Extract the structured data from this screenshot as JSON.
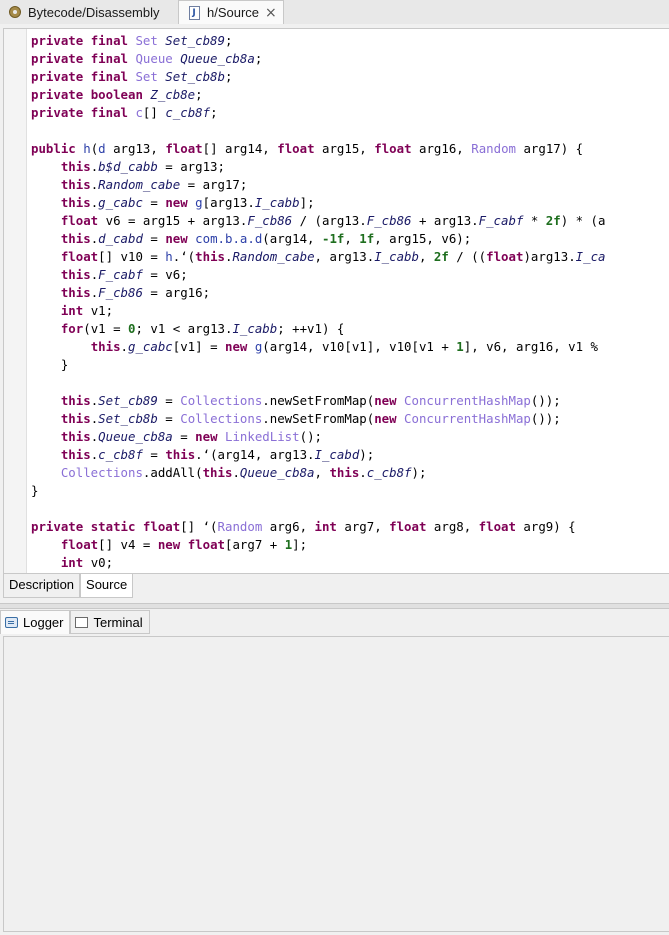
{
  "top_tabs": [
    {
      "label": "Bytecode/Disassembly",
      "icon": "gear-icon"
    },
    {
      "label": "h/Source",
      "icon": "java-file-icon",
      "closable": true
    }
  ],
  "code_lines": [
    [
      [
        "kw",
        "private "
      ],
      [
        "kw",
        "final "
      ],
      [
        "ty",
        "Set "
      ],
      [
        "fd",
        "Set_cb89"
      ],
      [
        "p",
        ";"
      ]
    ],
    [
      [
        "kw",
        "private "
      ],
      [
        "kw",
        "final "
      ],
      [
        "ty",
        "Queue "
      ],
      [
        "fd",
        "Queue_cb8a"
      ],
      [
        "p",
        ";"
      ]
    ],
    [
      [
        "kw",
        "private "
      ],
      [
        "kw",
        "final "
      ],
      [
        "ty",
        "Set "
      ],
      [
        "fd",
        "Set_cb8b"
      ],
      [
        "p",
        ";"
      ]
    ],
    [
      [
        "kw",
        "private "
      ],
      [
        "kw",
        "boolean "
      ],
      [
        "fd",
        "Z_cb8e"
      ],
      [
        "p",
        ";"
      ]
    ],
    [
      [
        "kw",
        "private "
      ],
      [
        "kw",
        "final "
      ],
      [
        "ty",
        "c"
      ],
      [
        "p",
        "[] "
      ],
      [
        "fd",
        "c_cb8f"
      ],
      [
        "p",
        ";"
      ]
    ],
    [],
    [
      [
        "kw",
        "public "
      ],
      [
        "cls",
        "h"
      ],
      [
        "p",
        "("
      ],
      [
        "cls",
        "d"
      ],
      [
        "p",
        " arg13, "
      ],
      [
        "kw",
        "float"
      ],
      [
        "p",
        "[] arg14, "
      ],
      [
        "kw",
        "float"
      ],
      [
        "p",
        " arg15, "
      ],
      [
        "kw",
        "float"
      ],
      [
        "p",
        " arg16, "
      ],
      [
        "ty",
        "Random"
      ],
      [
        "p",
        " arg17) {"
      ]
    ],
    [
      [
        "p",
        "    "
      ],
      [
        "kw",
        "this"
      ],
      [
        "p",
        "."
      ],
      [
        "fd",
        "b$d_cabb"
      ],
      [
        "p",
        " = arg13;"
      ]
    ],
    [
      [
        "p",
        "    "
      ],
      [
        "kw",
        "this"
      ],
      [
        "p",
        "."
      ],
      [
        "fd",
        "Random_cabe"
      ],
      [
        "p",
        " = arg17;"
      ]
    ],
    [
      [
        "p",
        "    "
      ],
      [
        "kw",
        "this"
      ],
      [
        "p",
        "."
      ],
      [
        "fd",
        "g_cabc"
      ],
      [
        "p",
        " = "
      ],
      [
        "kw",
        "new "
      ],
      [
        "cls",
        "g"
      ],
      [
        "p",
        "[arg13."
      ],
      [
        "fd",
        "I_cabb"
      ],
      [
        "p",
        "];"
      ]
    ],
    [
      [
        "p",
        "    "
      ],
      [
        "kw",
        "float"
      ],
      [
        "p",
        " v6 = arg15 + arg13."
      ],
      [
        "fd",
        "F_cb86"
      ],
      [
        "p",
        " / (arg13."
      ],
      [
        "fd",
        "F_cb86"
      ],
      [
        "p",
        " + arg13."
      ],
      [
        "fd",
        "F_cabf"
      ],
      [
        "p",
        " * "
      ],
      [
        "nm",
        "2f"
      ],
      [
        "p",
        ") * (a"
      ]
    ],
    [
      [
        "p",
        "    "
      ],
      [
        "kw",
        "this"
      ],
      [
        "p",
        "."
      ],
      [
        "fd",
        "d_cabd"
      ],
      [
        "p",
        " = "
      ],
      [
        "kw",
        "new "
      ],
      [
        "cls",
        "com.b.a.d"
      ],
      [
        "p",
        "(arg14, "
      ],
      [
        "nm",
        "-1f"
      ],
      [
        "p",
        ", "
      ],
      [
        "nm",
        "1f"
      ],
      [
        "p",
        ", arg15, v6);"
      ]
    ],
    [
      [
        "p",
        "    "
      ],
      [
        "kw",
        "float"
      ],
      [
        "p",
        "[] v10 = "
      ],
      [
        "cls",
        "h"
      ],
      [
        "p",
        ".‘("
      ],
      [
        "kw",
        "this"
      ],
      [
        "p",
        "."
      ],
      [
        "fd",
        "Random_cabe"
      ],
      [
        "p",
        ", arg13."
      ],
      [
        "fd",
        "I_cabb"
      ],
      [
        "p",
        ", "
      ],
      [
        "nm",
        "2f"
      ],
      [
        "p",
        " / (("
      ],
      [
        "kw",
        "float"
      ],
      [
        "p",
        ")arg13."
      ],
      [
        "fd",
        "I_ca"
      ]
    ],
    [
      [
        "p",
        "    "
      ],
      [
        "kw",
        "this"
      ],
      [
        "p",
        "."
      ],
      [
        "fd",
        "F_cabf"
      ],
      [
        "p",
        " = v6;"
      ]
    ],
    [
      [
        "p",
        "    "
      ],
      [
        "kw",
        "this"
      ],
      [
        "p",
        "."
      ],
      [
        "fd",
        "F_cb86"
      ],
      [
        "p",
        " = arg16;"
      ]
    ],
    [
      [
        "p",
        "    "
      ],
      [
        "kw",
        "int"
      ],
      [
        "p",
        " v1;"
      ]
    ],
    [
      [
        "p",
        "    "
      ],
      [
        "kw",
        "for"
      ],
      [
        "p",
        "(v1 = "
      ],
      [
        "nm",
        "0"
      ],
      [
        "p",
        "; v1 < arg13."
      ],
      [
        "fd",
        "I_cabb"
      ],
      [
        "p",
        "; ++v1) {"
      ]
    ],
    [
      [
        "p",
        "        "
      ],
      [
        "kw",
        "this"
      ],
      [
        "p",
        "."
      ],
      [
        "fd",
        "g_cabc"
      ],
      [
        "p",
        "[v1] = "
      ],
      [
        "kw",
        "new "
      ],
      [
        "cls",
        "g"
      ],
      [
        "p",
        "(arg14, v10[v1], v10[v1 + "
      ],
      [
        "nm",
        "1"
      ],
      [
        "p",
        "], v6, arg16, v1 %"
      ]
    ],
    [
      [
        "p",
        "    }"
      ]
    ],
    [],
    [
      [
        "p",
        "    "
      ],
      [
        "kw",
        "this"
      ],
      [
        "p",
        "."
      ],
      [
        "fd",
        "Set_cb89"
      ],
      [
        "p",
        " = "
      ],
      [
        "ty",
        "Collections"
      ],
      [
        "p",
        ".newSetFromMap("
      ],
      [
        "kw",
        "new "
      ],
      [
        "ty",
        "ConcurrentHashMap"
      ],
      [
        "p",
        "());"
      ]
    ],
    [
      [
        "p",
        "    "
      ],
      [
        "kw",
        "this"
      ],
      [
        "p",
        "."
      ],
      [
        "fd",
        "Set_cb8b"
      ],
      [
        "p",
        " = "
      ],
      [
        "ty",
        "Collections"
      ],
      [
        "p",
        ".newSetFromMap("
      ],
      [
        "kw",
        "new "
      ],
      [
        "ty",
        "ConcurrentHashMap"
      ],
      [
        "p",
        "());"
      ]
    ],
    [
      [
        "p",
        "    "
      ],
      [
        "kw",
        "this"
      ],
      [
        "p",
        "."
      ],
      [
        "fd",
        "Queue_cb8a"
      ],
      [
        "p",
        " = "
      ],
      [
        "kw",
        "new "
      ],
      [
        "ty",
        "LinkedList"
      ],
      [
        "p",
        "();"
      ]
    ],
    [
      [
        "p",
        "    "
      ],
      [
        "kw",
        "this"
      ],
      [
        "p",
        "."
      ],
      [
        "fd",
        "c_cb8f"
      ],
      [
        "p",
        " = "
      ],
      [
        "kw",
        "this"
      ],
      [
        "p",
        ".‘(arg14, arg13."
      ],
      [
        "fd",
        "I_cabd"
      ],
      [
        "p",
        ");"
      ]
    ],
    [
      [
        "p",
        "    "
      ],
      [
        "ty",
        "Collections"
      ],
      [
        "p",
        ".addAll("
      ],
      [
        "kw",
        "this"
      ],
      [
        "p",
        "."
      ],
      [
        "fd",
        "Queue_cb8a"
      ],
      [
        "p",
        ", "
      ],
      [
        "kw",
        "this"
      ],
      [
        "p",
        "."
      ],
      [
        "fd",
        "c_cb8f"
      ],
      [
        "p",
        ");"
      ]
    ],
    [
      [
        "p",
        "}"
      ]
    ],
    [],
    [
      [
        "kw",
        "private "
      ],
      [
        "kw",
        "static "
      ],
      [
        "kw",
        "float"
      ],
      [
        "p",
        "[] ‘("
      ],
      [
        "ty",
        "Random"
      ],
      [
        "p",
        " arg6, "
      ],
      [
        "kw",
        "int"
      ],
      [
        "p",
        " arg7, "
      ],
      [
        "kw",
        "float"
      ],
      [
        "p",
        " arg8, "
      ],
      [
        "kw",
        "float"
      ],
      [
        "p",
        " arg9) {"
      ]
    ],
    [
      [
        "p",
        "    "
      ],
      [
        "kw",
        "float"
      ],
      [
        "p",
        "[] v4 = "
      ],
      [
        "kw",
        "new "
      ],
      [
        "kw",
        "float"
      ],
      [
        "p",
        "[arg7 + "
      ],
      [
        "nm",
        "1"
      ],
      [
        "p",
        "];"
      ]
    ],
    [
      [
        "p",
        "    "
      ],
      [
        "kw",
        "int"
      ],
      [
        "p",
        " v0;"
      ]
    ]
  ],
  "editor_tabs": {
    "description": "Description",
    "source": "Source"
  },
  "bottom_tabs": {
    "logger": "Logger",
    "terminal": "Terminal"
  }
}
